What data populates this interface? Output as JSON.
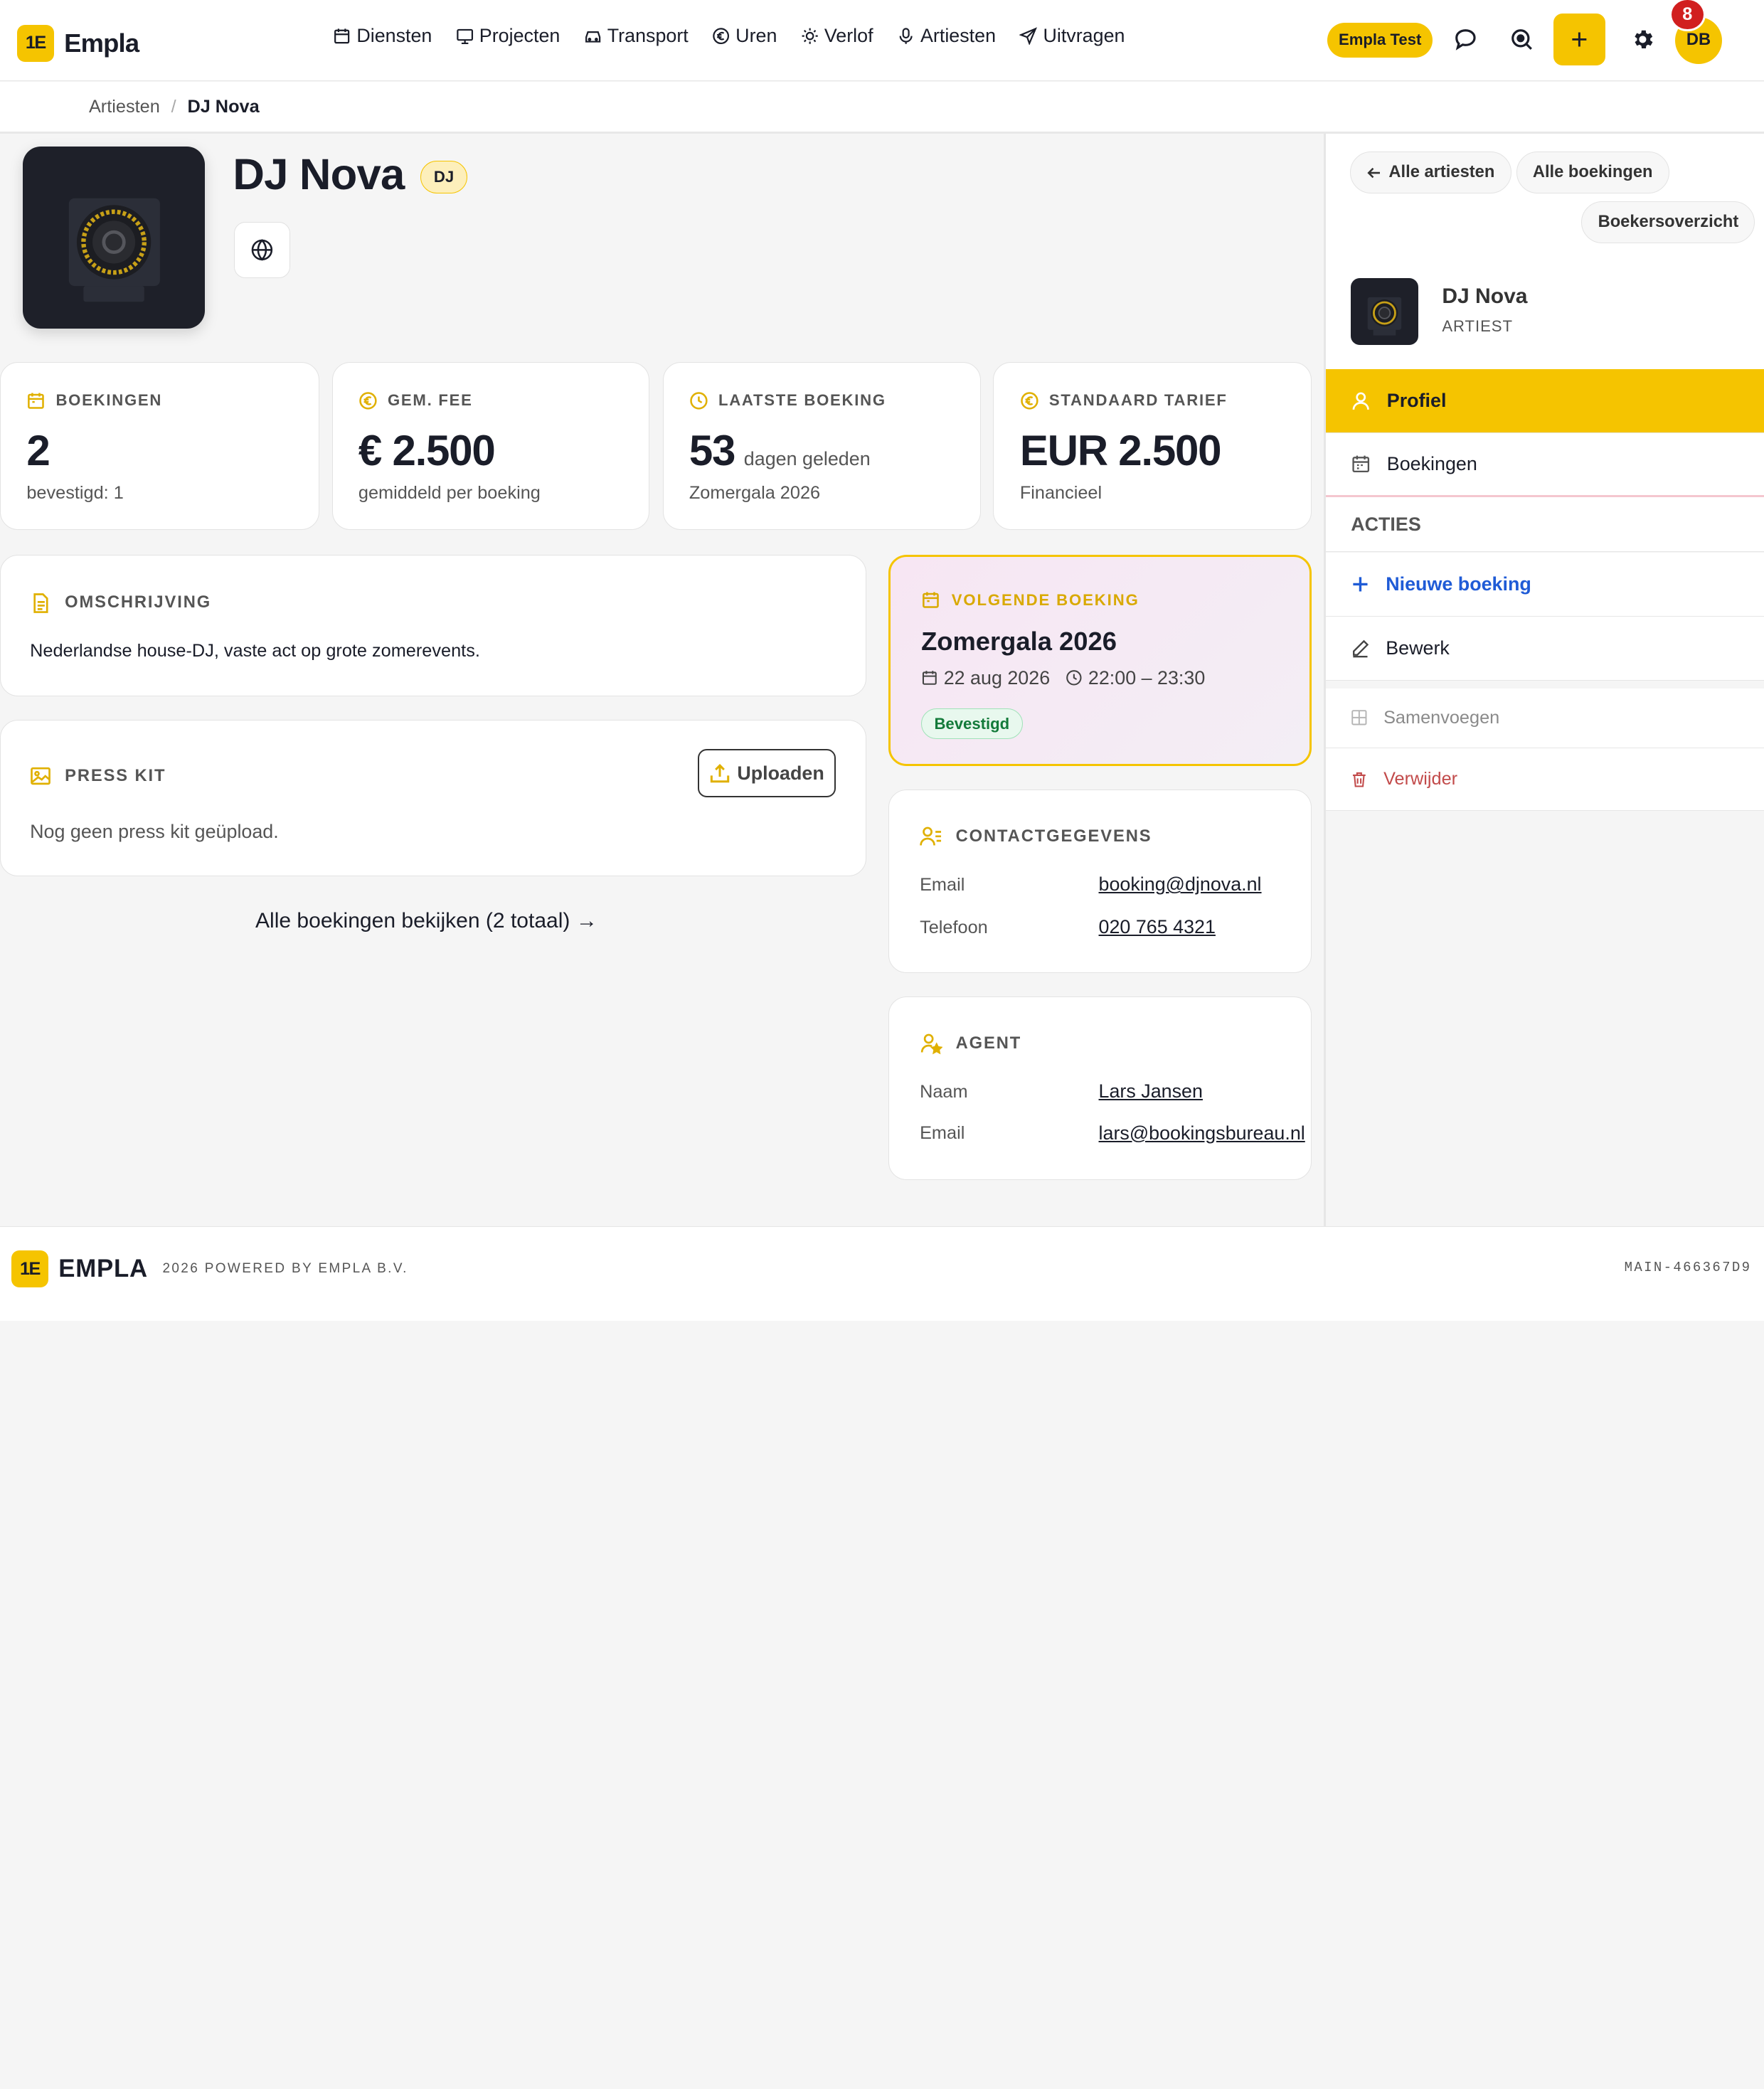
{
  "app": {
    "name": "Empla",
    "logo_mark": "1E",
    "env_badge": "Empla Test",
    "notifications_count": "8",
    "user_initials": "DB",
    "plus_label": "+"
  },
  "nav": [
    {
      "label": "Diensten",
      "icon": "calendar-icon"
    },
    {
      "label": "Projecten",
      "icon": "monitor-icon"
    },
    {
      "label": "Transport",
      "icon": "car-icon"
    },
    {
      "label": "Uren",
      "icon": "euro-icon"
    },
    {
      "label": "Verlof",
      "icon": "sun-icon"
    },
    {
      "label": "Artiesten",
      "icon": "microphone-icon"
    },
    {
      "label": "Uitvragen",
      "icon": "send-icon"
    }
  ],
  "breadcrumb": {
    "parent": "Artiesten",
    "separator": "/",
    "current": "DJ Nova"
  },
  "profile": {
    "name": "DJ Nova",
    "badge": "DJ"
  },
  "stats": [
    {
      "label": "BOEKINGEN",
      "value": "2",
      "unit": "",
      "sub": "bevestigd: 1",
      "icon": "calendar-icon"
    },
    {
      "label": "GEM. FEE",
      "value": "€ 2.500",
      "unit": "",
      "sub": "gemiddeld per boeking",
      "icon": "euro-icon"
    },
    {
      "label": "LAATSTE BOEKING",
      "value": "53",
      "unit": "dagen geleden",
      "sub": "Zomergala 2026",
      "icon": "clock-icon"
    },
    {
      "label": "STANDAARD TARIEF",
      "value": "EUR 2.500",
      "unit": "",
      "sub": "Financieel",
      "icon": "euro-icon"
    }
  ],
  "description": {
    "title": "OMSCHRIJVING",
    "text": "Nederlandse house-DJ, vaste act op grote zomerevents."
  },
  "presskit": {
    "title": "PRESS KIT",
    "empty": "Nog geen press kit geüpload.",
    "upload_label": "Uploaden"
  },
  "all_bookings_link": "Alle boekingen bekijken (2 totaal) →",
  "next_booking": {
    "label": "VOLGENDE BOEKING",
    "title": "Zomergala 2026",
    "date": "22 aug 2026",
    "time": "22:00 – 23:30",
    "status": "Bevestigd"
  },
  "contact": {
    "title": "CONTACTGEGEVENS",
    "email_label": "Email",
    "email": "booking@djnova.nl",
    "phone_label": "Telefoon",
    "phone": "020 765 4321"
  },
  "agent": {
    "title": "AGENT",
    "name_label": "Naam",
    "name": "Lars Jansen",
    "email_label": "Email",
    "email": "lars@bookingsbureau.nl"
  },
  "sidebar": {
    "back_label": "Alle artiesten",
    "all_bookings_label": "Alle boekingen",
    "overview_label": "Boekersoverzicht",
    "name": "DJ Nova",
    "role": "ARTIEST",
    "items": [
      {
        "label": "Profiel",
        "icon": "user-icon"
      },
      {
        "label": "Boekingen",
        "icon": "calendar-icon"
      }
    ],
    "actions_heading": "ACTIES",
    "actions": [
      {
        "label": "Nieuwe boeking",
        "icon": "plus-icon",
        "color": "#1f5bd6"
      },
      {
        "label": "Bewerk",
        "icon": "pencil-icon",
        "color": "#1a1d29"
      },
      {
        "label": "Samenvoegen",
        "icon": "merge-icon",
        "color": "#8a8a8a"
      },
      {
        "label": "Verwijder",
        "icon": "trash-icon",
        "color": "#c24a4a"
      }
    ]
  },
  "footer": {
    "mark": "1E",
    "brand": "EMPLA",
    "copy": "2026 POWERED BY EMPLA B.V.",
    "build": "MAIN-466367D9"
  },
  "colors": {
    "accent": "#f5c400",
    "text": "#1a1d29",
    "success": "#137a3a",
    "danger": "#c24a4a",
    "link": "#1f5bd6"
  }
}
